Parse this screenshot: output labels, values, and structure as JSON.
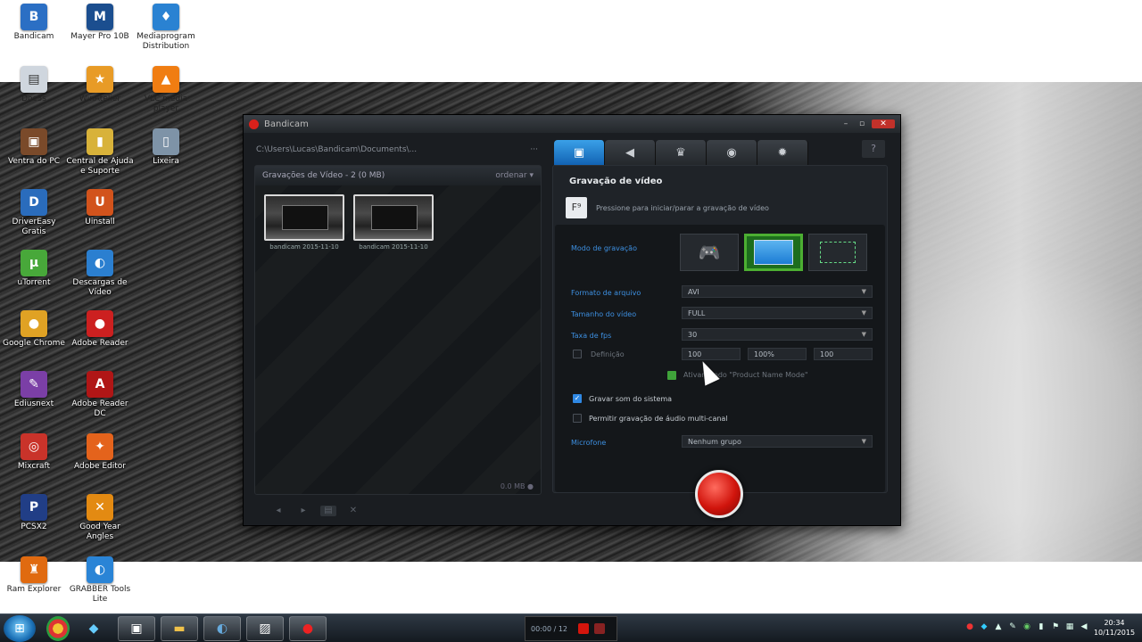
{
  "desktop": {
    "icons": [
      {
        "label": "Bandicam",
        "glyph": "B",
        "color": "#2b6fc4"
      },
      {
        "label": "Mayer Pro 10B",
        "glyph": "M",
        "color": "#1b4e8f"
      },
      {
        "label": "Mediaprogram Distribution",
        "glyph": "♦",
        "color": "#2a82d2"
      },
      {
        "label": "Doc3s",
        "glyph": "▤",
        "color": "#cfd6de"
      },
      {
        "label": "WinAtelier",
        "glyph": "★",
        "color": "#e89b26"
      },
      {
        "label": "VLC media player",
        "glyph": "▲",
        "color": "#f07d12"
      },
      {
        "label": "Ventra do PC",
        "glyph": "▣",
        "color": "#7a4a2a"
      },
      {
        "label": "Central de Ajuda e Suporte",
        "glyph": "▮",
        "color": "#d8b23a"
      },
      {
        "label": "Lixeira",
        "glyph": "▯",
        "color": "#7e93a7"
      },
      {
        "label": "DriverEasy Gratis",
        "glyph": "D",
        "color": "#2a6cbc"
      },
      {
        "label": "Uinstall",
        "glyph": "U",
        "color": "#d2531c"
      },
      {
        "label": "uTorrent",
        "glyph": "µ",
        "color": "#48a83a"
      },
      {
        "label": "Descargas de Vídeo",
        "glyph": "◐",
        "color": "#2b7fd0"
      },
      {
        "label": "Google Chrome",
        "glyph": "●",
        "color": "#e0a224"
      },
      {
        "label": "Adobe Reader",
        "glyph": "●",
        "color": "#cc2020"
      },
      {
        "label": "Ediusnext",
        "glyph": "✎",
        "color": "#7b3fa6"
      },
      {
        "label": "Adobe Reader DC",
        "glyph": "A",
        "color": "#b01616"
      },
      {
        "label": "Mixcraft",
        "glyph": "◎",
        "color": "#c9332a"
      },
      {
        "label": "Adobe Editor",
        "glyph": "✦",
        "color": "#e4631c"
      },
      {
        "label": "PCSX2",
        "glyph": "P",
        "color": "#213e86"
      },
      {
        "label": "Good Year Angles",
        "glyph": "✕",
        "color": "#e38a12"
      },
      {
        "label": "Ram Explorer",
        "glyph": "♜",
        "color": "#e06a10"
      },
      {
        "label": "GRABBER Tools Lite",
        "glyph": "◐",
        "color": "#2a84d6"
      }
    ]
  },
  "app": {
    "title": "Bandicam",
    "path": "C:\\Users\\Lucas\\Bandicam\\Documents\\...",
    "path_more": "···",
    "left_header": "Gravações de Vídeo - 2 (0 MB)",
    "left_sort": "ordenar ▾",
    "thumbs": [
      {
        "caption": "bandicam 2015-11-10"
      },
      {
        "caption": "bandicam 2015-11-10"
      }
    ],
    "left_footer": "0.0 MB ●",
    "tabs": [
      {
        "icon": "▣",
        "name": "video"
      },
      {
        "icon": "◀",
        "name": "audio"
      },
      {
        "icon": "♛",
        "name": "game"
      },
      {
        "icon": "◉",
        "name": "screenshot"
      },
      {
        "icon": "✹",
        "name": "settings"
      }
    ],
    "help": "?",
    "section_title": "Gravação de vídeo",
    "info_text": "Pressione para iniciar/parar a gravação de vídeo",
    "info_icon": "F⁹",
    "labels": {
      "mode": "Modo de gravação",
      "format": "Formato de arquivo",
      "size": "Tamanho do vídeo",
      "fps": "Taxa de fps",
      "fps_limit": "Definição",
      "sound": "Gravar som do sistema",
      "multi": "Permitir gravação de áudio multi-canal",
      "mic": "Microfone"
    },
    "values": {
      "format": "AVI",
      "size": "FULL",
      "fps": "30",
      "fps_a": "100",
      "fps_b": "100%",
      "fps_c": "100",
      "mic": "Nenhum grupo",
      "hint": "Ativar modo \"Product Name Mode\""
    }
  },
  "taskbar": {
    "widget_time": "00:00 / 12",
    "clock_time": "20:34",
    "clock_date": "10/11/2015"
  }
}
